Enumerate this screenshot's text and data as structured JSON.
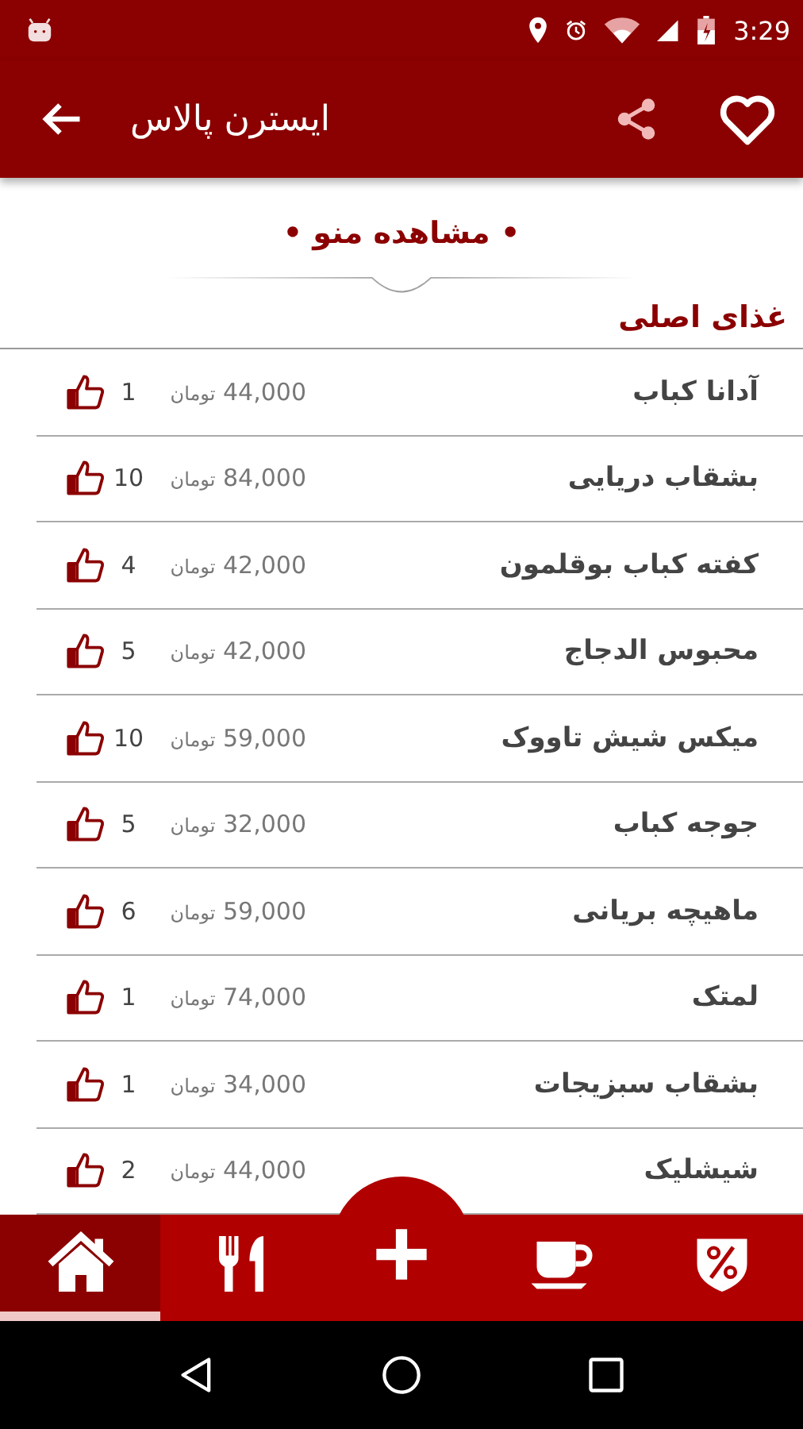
{
  "status_bar": {
    "time": "3:29"
  },
  "toolbar": {
    "title": "ایسترن پالاس"
  },
  "menu_heading": "• مشاهده منو •",
  "section_title": "غذای اصلی",
  "items": [
    {
      "name": "آدانا کباب",
      "price": "44,000",
      "currency": "تومان",
      "likes": "1"
    },
    {
      "name": "بشقاب دریایی",
      "price": "84,000",
      "currency": "تومان",
      "likes": "10"
    },
    {
      "name": "کفته کباب بوقلمون",
      "price": "42,000",
      "currency": "تومان",
      "likes": "4"
    },
    {
      "name": "محبوس الدجاج",
      "price": "42,000",
      "currency": "تومان",
      "likes": "5"
    },
    {
      "name": "میکس شیش تاووک",
      "price": "59,000",
      "currency": "تومان",
      "likes": "10"
    },
    {
      "name": "جوجه کباب",
      "price": "32,000",
      "currency": "تومان",
      "likes": "5"
    },
    {
      "name": "ماهیچه بریانی",
      "price": "59,000",
      "currency": "تومان",
      "likes": "6"
    },
    {
      "name": "لمتک",
      "price": "74,000",
      "currency": "تومان",
      "likes": "1"
    },
    {
      "name": "بشقاب سبزیجات",
      "price": "34,000",
      "currency": "تومان",
      "likes": "1"
    },
    {
      "name": "شیشلیک",
      "price": "44,000",
      "currency": "تومان",
      "likes": "2"
    }
  ],
  "bottom_nav": [
    {
      "kind": "home",
      "selected": true
    },
    {
      "kind": "cutlery",
      "selected": false
    },
    {
      "kind": "add",
      "selected": false
    },
    {
      "kind": "cup",
      "selected": false
    },
    {
      "kind": "discount",
      "selected": false
    }
  ]
}
